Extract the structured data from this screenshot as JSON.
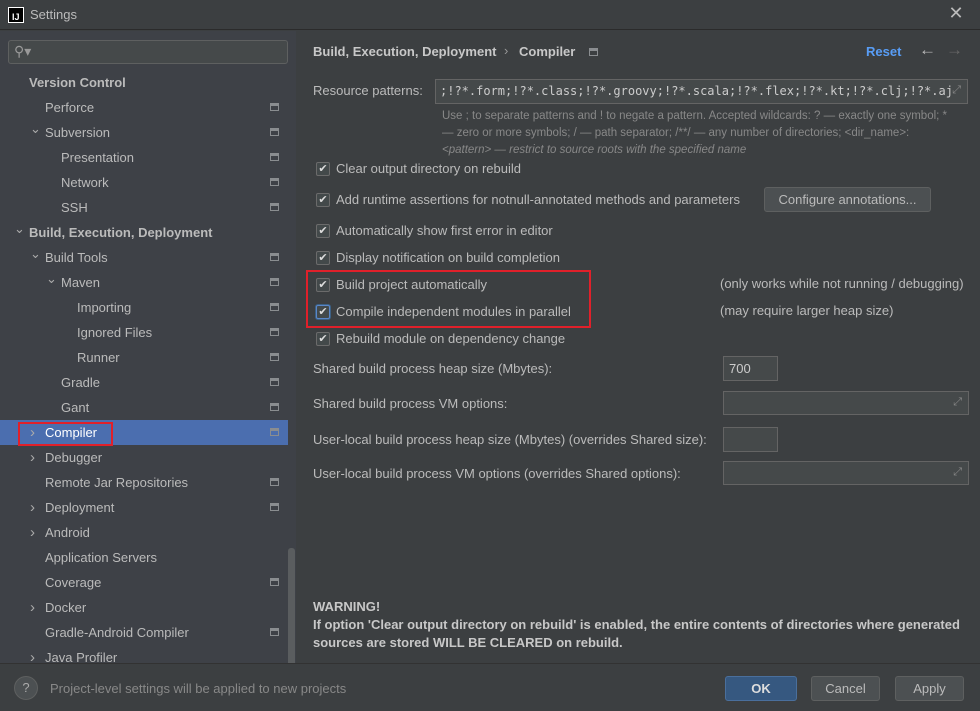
{
  "window": {
    "title": "Settings",
    "close_icon": "close-icon"
  },
  "sidebar": {
    "search_placeholder": "",
    "items": [
      {
        "label": "Version Control",
        "level": 0,
        "bold": true,
        "arrow": "",
        "page": false
      },
      {
        "label": "Perforce",
        "level": 1,
        "arrow": "",
        "page": true
      },
      {
        "label": "Subversion",
        "level": 1,
        "arrow": "expanded",
        "page": true
      },
      {
        "label": "Presentation",
        "level": 2,
        "arrow": "",
        "page": true
      },
      {
        "label": "Network",
        "level": 2,
        "arrow": "",
        "page": true
      },
      {
        "label": "SSH",
        "level": 2,
        "arrow": "",
        "page": true
      },
      {
        "label": "Build, Execution, Deployment",
        "level": 0,
        "bold": true,
        "arrow": "expanded",
        "page": false
      },
      {
        "label": "Build Tools",
        "level": 1,
        "arrow": "expanded",
        "page": true
      },
      {
        "label": "Maven",
        "level": 2,
        "arrow": "expanded",
        "page": true
      },
      {
        "label": "Importing",
        "level": 3,
        "arrow": "",
        "page": true
      },
      {
        "label": "Ignored Files",
        "level": 3,
        "arrow": "",
        "page": true
      },
      {
        "label": "Runner",
        "level": 3,
        "arrow": "",
        "page": true
      },
      {
        "label": "Gradle",
        "level": 2,
        "arrow": "",
        "page": true
      },
      {
        "label": "Gant",
        "level": 2,
        "arrow": "",
        "page": true
      },
      {
        "label": "Compiler",
        "level": 1,
        "arrow": "collapsed",
        "page": true,
        "selected": true
      },
      {
        "label": "Debugger",
        "level": 1,
        "arrow": "collapsed",
        "page": false
      },
      {
        "label": "Remote Jar Repositories",
        "level": 1,
        "arrow": "",
        "page": true
      },
      {
        "label": "Deployment",
        "level": 1,
        "arrow": "collapsed",
        "page": true
      },
      {
        "label": "Android",
        "level": 1,
        "arrow": "collapsed",
        "page": false
      },
      {
        "label": "Application Servers",
        "level": 1,
        "arrow": "",
        "page": false
      },
      {
        "label": "Coverage",
        "level": 1,
        "arrow": "",
        "page": true
      },
      {
        "label": "Docker",
        "level": 1,
        "arrow": "collapsed",
        "page": false
      },
      {
        "label": "Gradle-Android Compiler",
        "level": 1,
        "arrow": "",
        "page": true
      },
      {
        "label": "Java Profiler",
        "level": 1,
        "arrow": "collapsed",
        "page": false
      }
    ]
  },
  "header": {
    "breadcrumb_parent": "Build, Execution, Deployment",
    "breadcrumb_current": "Compiler",
    "reset": "Reset"
  },
  "resource": {
    "label": "Resource patterns:",
    "value": ";!?*.form;!?*.class;!?*.groovy;!?*.scala;!?*.flex;!?*.kt;!?*.clj;!?*.aj",
    "help1": "Use ; to separate patterns and ! to negate a pattern. Accepted wildcards: ? — exactly one symbol; *",
    "help2": "— zero or more symbols; / — path separator; /**/ — any number of directories; <dir_name>:",
    "help3": "<pattern> — restrict to source roots with the specified name"
  },
  "options": [
    {
      "label": "Clear output directory on rebuild",
      "checked": true
    },
    {
      "label": "Add runtime assertions for notnull-annotated methods and parameters",
      "checked": true
    },
    {
      "label": "Automatically show first error in editor",
      "checked": true
    },
    {
      "label": "Display notification on build completion",
      "checked": true
    },
    {
      "label": "Build project automatically",
      "checked": true
    },
    {
      "label": "Compile independent modules in parallel",
      "checked": true
    },
    {
      "label": "Rebuild module on dependency change",
      "checked": true
    }
  ],
  "configure_annotations": "Configure annotations...",
  "notes": {
    "auto": "(only works while not running / debugging)",
    "parallel": "(may require larger heap size)"
  },
  "fields": [
    {
      "label": "Shared build process heap size (Mbytes):",
      "value": "700"
    },
    {
      "label": "Shared build process VM options:",
      "value": ""
    },
    {
      "label": "User-local build process heap size (Mbytes) (overrides Shared size):",
      "value": ""
    },
    {
      "label": "User-local build process VM options (overrides Shared options):",
      "value": ""
    }
  ],
  "warning": {
    "title": "WARNING!",
    "line1": "If option 'Clear output directory on rebuild' is enabled, the entire contents of directories where generated",
    "line2": "sources are stored WILL BE CLEARED on rebuild."
  },
  "footer": {
    "hint": "Project-level settings will be applied to new projects",
    "ok": "OK",
    "cancel": "Cancel",
    "apply": "Apply"
  },
  "colors": {
    "accent": "#589df6",
    "selection": "#4b6eaf",
    "highlight": "#e0202a"
  }
}
